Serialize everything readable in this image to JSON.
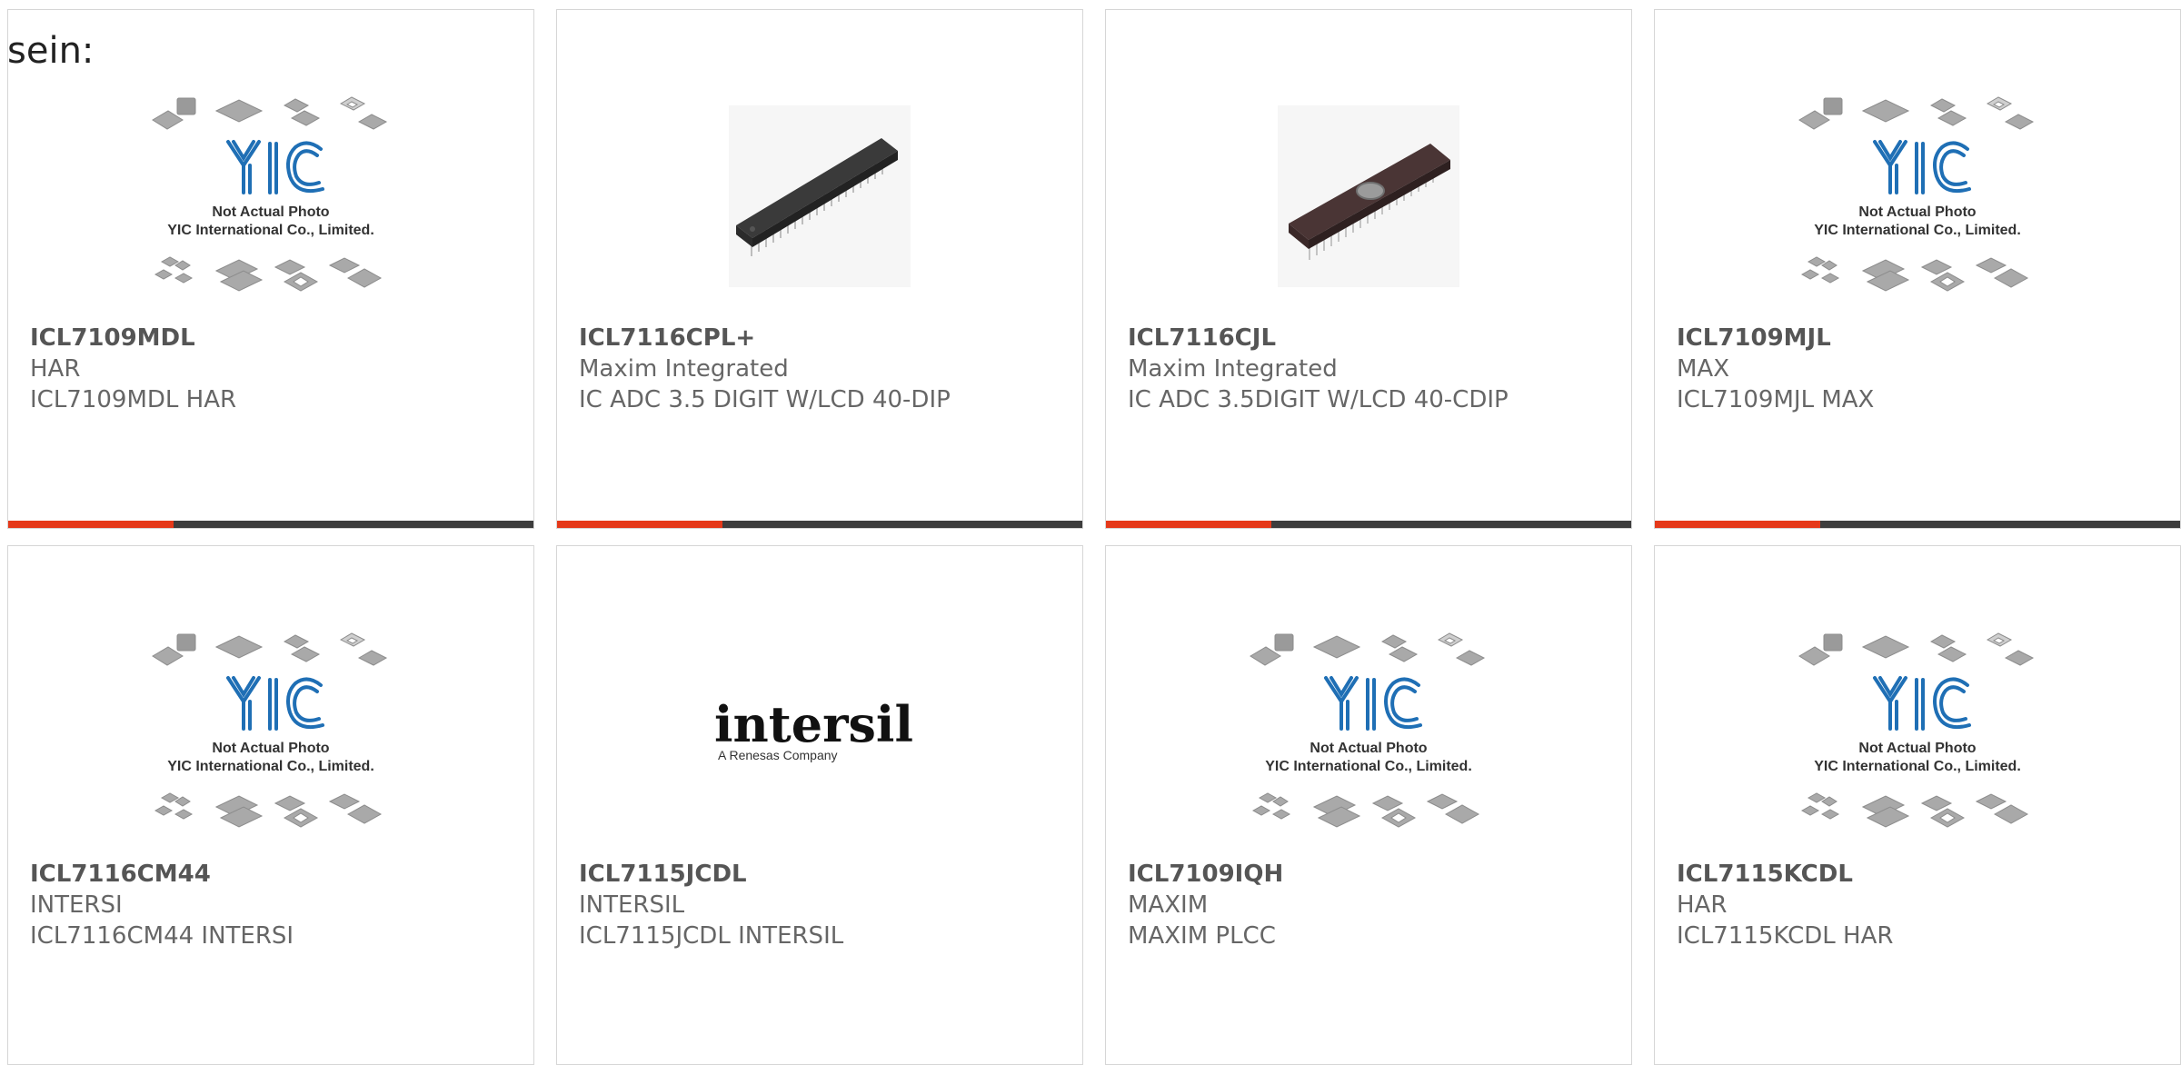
{
  "page": {
    "heading": "sein:"
  },
  "placeholder": {
    "brand": "YIC",
    "line1": "Not Actual Photo",
    "line2": "YIC International Co., Limited."
  },
  "logo": {
    "brand": "intersil",
    "tagline": "A Renesas Company"
  },
  "colors": {
    "accent": "#e5391a",
    "bar": "#3d3d3d",
    "border": "#d6d6d6",
    "text": "#666666",
    "yic_blue": "#1f6fb5"
  },
  "products": [
    {
      "part": "ICL7109MDL",
      "manufacturer": "HAR",
      "description": "ICL7109MDL HAR",
      "image": "not-actual-photo-placeholder"
    },
    {
      "part": "ICL7116CPL+",
      "manufacturer": "Maxim Integrated",
      "description": "IC ADC 3.5 DIGIT W/LCD 40-DIP",
      "image": "dip-40-chip-photo"
    },
    {
      "part": "ICL7116CJL",
      "manufacturer": "Maxim Integrated",
      "description": "IC ADC 3.5DIGIT W/LCD 40-CDIP",
      "image": "cdip-40-chip-photo"
    },
    {
      "part": "ICL7109MJL",
      "manufacturer": "MAX",
      "description": "ICL7109MJL MAX",
      "image": "not-actual-photo-placeholder"
    },
    {
      "part": "ICL7116CM44",
      "manufacturer": "INTERSI",
      "description": "ICL7116CM44 INTERSI",
      "image": "not-actual-photo-placeholder"
    },
    {
      "part": "ICL7115JCDL",
      "manufacturer": "INTERSIL",
      "description": "ICL7115JCDL INTERSIL",
      "image": "intersil-logo"
    },
    {
      "part": "ICL7109IQH",
      "manufacturer": "MAXIM",
      "description": "MAXIM PLCC",
      "image": "not-actual-photo-placeholder"
    },
    {
      "part": "ICL7115KCDL",
      "manufacturer": "HAR",
      "description": "ICL7115KCDL HAR",
      "image": "not-actual-photo-placeholder"
    }
  ]
}
